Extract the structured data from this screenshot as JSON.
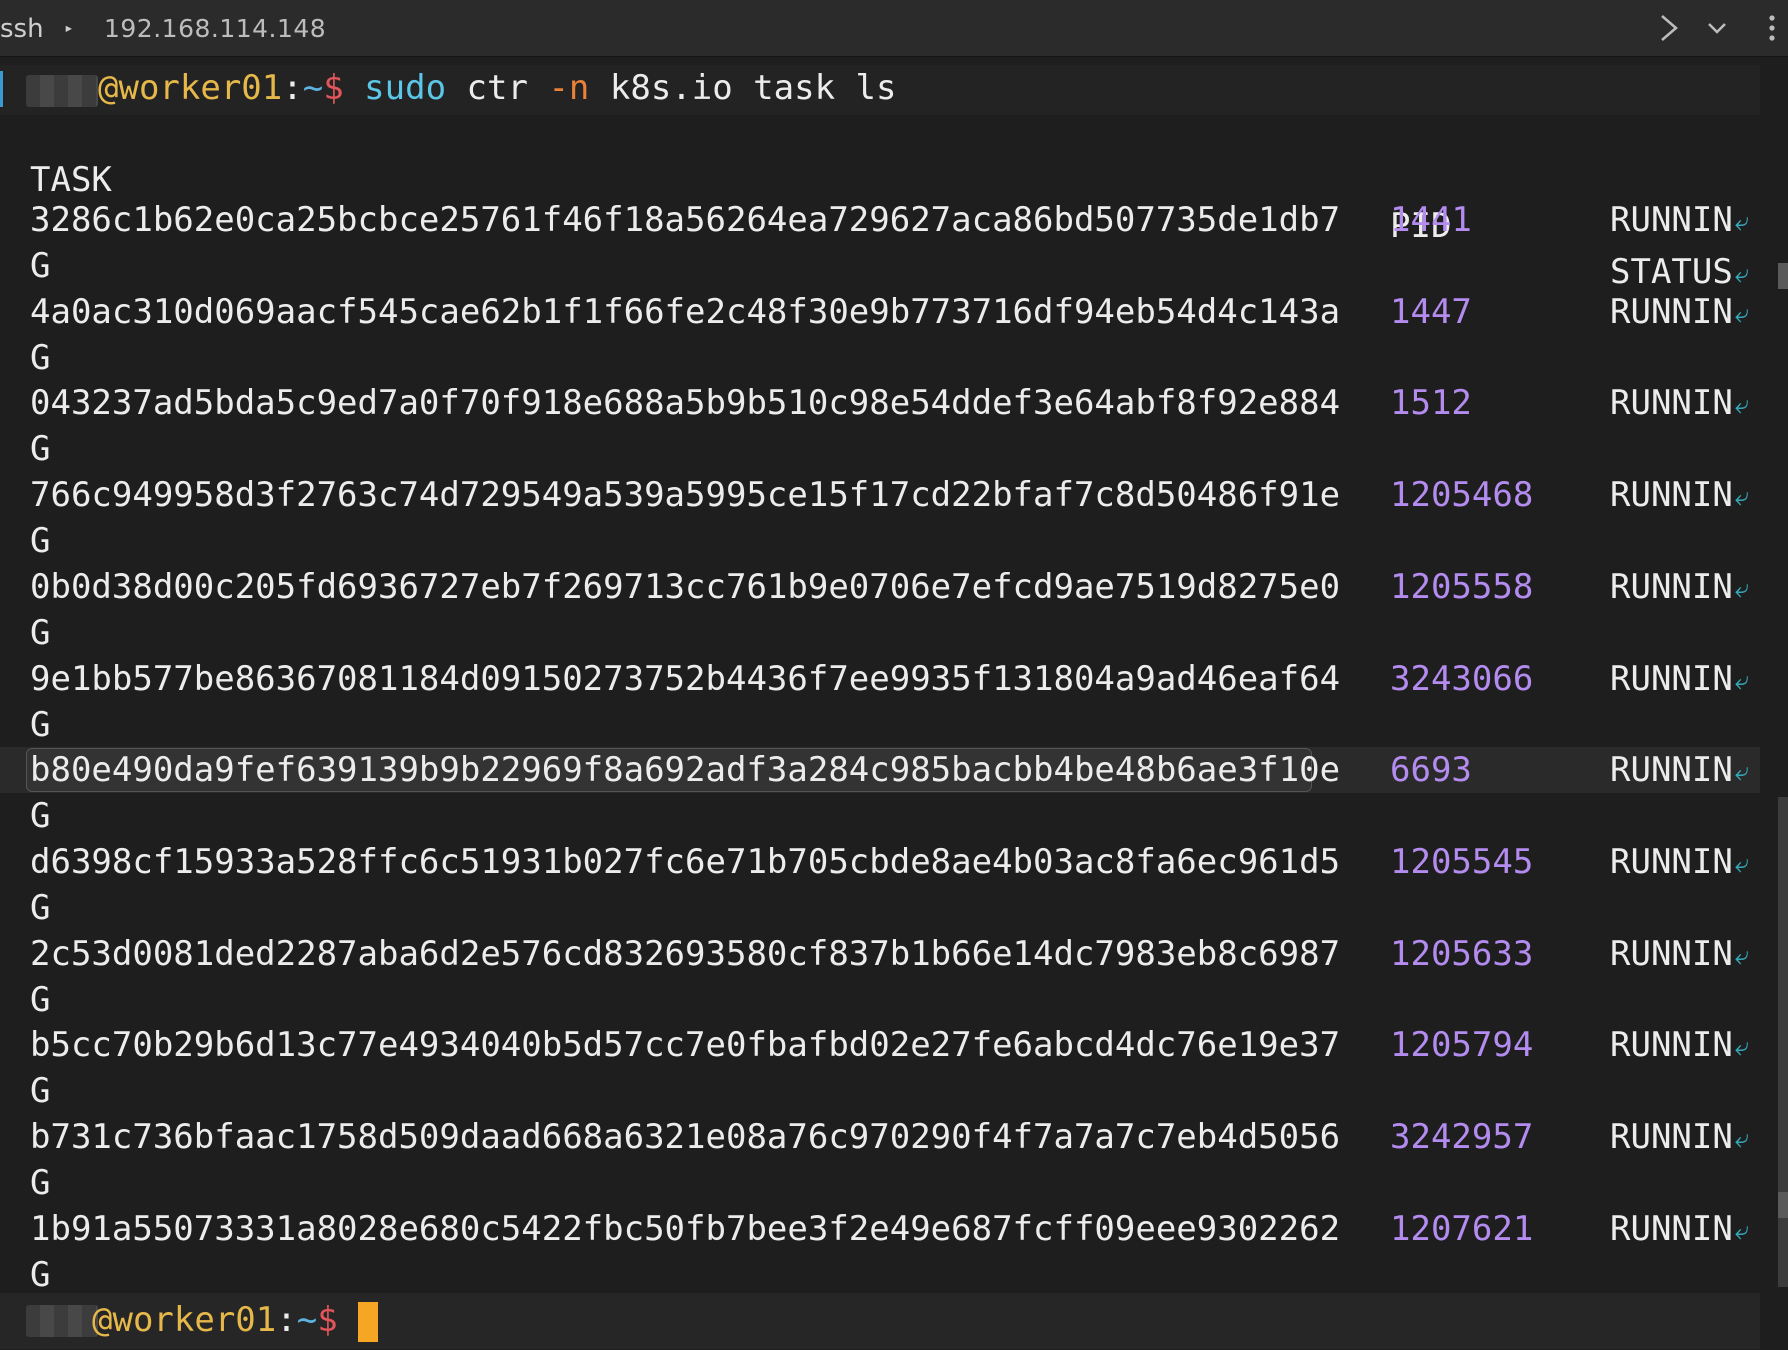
{
  "tabbar": {
    "app": "ssh",
    "separator": "▸",
    "host": "192.168.114.148",
    "next_glyph": "›",
    "dropdown_glyph": "⌄",
    "menu_glyph": "⋮"
  },
  "prompt": {
    "host": "@worker01",
    "colon": ":",
    "path": "~",
    "dollar": "$"
  },
  "command": {
    "sudo": "sudo",
    "ctr": "ctr",
    "flag": "-n",
    "rest": "k8s.io task ls"
  },
  "table": {
    "headers": {
      "task": "TASK",
      "pid": "PID",
      "status": "STATUS"
    },
    "wrap_char": "G",
    "rows": [
      {
        "task": "3286c1b62e0ca25bcbce25761f46f18a56264ea729627aca86bd507735de1db7",
        "pid": "1441",
        "status": "RUNNIN"
      },
      {
        "task": "4a0ac310d069aacf545cae62b1f1f66fe2c48f30e9b773716df94eb54d4c143a",
        "pid": "1447",
        "status": "RUNNIN"
      },
      {
        "task": "043237ad5bda5c9ed7a0f70f918e688a5b9b510c98e54ddef3e64abf8f92e884",
        "pid": "1512",
        "status": "RUNNIN"
      },
      {
        "task": "766c949958d3f2763c74d729549a539a5995ce15f17cd22bfaf7c8d50486f91e",
        "pid": "1205468",
        "status": "RUNNIN"
      },
      {
        "task": "0b0d38d00c205fd6936727eb7f269713cc761b9e0706e7efcd9ae7519d8275e0",
        "pid": "1205558",
        "status": "RUNNIN"
      },
      {
        "task": "9e1bb577be86367081184d09150273752b4436f7ee9935f131804a9ad46eaf64",
        "pid": "3243066",
        "status": "RUNNIN"
      },
      {
        "task": "b80e490da9fef639139b9b22969f8a692adf3a284c985bacbb4be48b6ae3f10e",
        "pid": "6693",
        "status": "RUNNIN"
      },
      {
        "task": "d6398cf15933a528ffc6c51931b027fc6e71b705cbde8ae4b03ac8fa6ec961d5",
        "pid": "1205545",
        "status": "RUNNIN"
      },
      {
        "task": "2c53d0081ded2287aba6d2e576cd832693580cf837b1b66e14dc7983eb8c6987",
        "pid": "1205633",
        "status": "RUNNIN"
      },
      {
        "task": "b5cc70b29b6d13c77e4934040b5d57cc7e0fbafbd02e27fe6abcd4dc76e19e37",
        "pid": "1205794",
        "status": "RUNNIN"
      },
      {
        "task": "b731c736bfaac1758d509daad668a6321e08a76c970290f4f7a7a7c7eb4d5056",
        "pid": "3242957",
        "status": "RUNNIN"
      },
      {
        "task": "1b91a55073331a8028e680c5422fbc50fb7bee3f2e49e687fcff09eee9302262",
        "pid": "1207621",
        "status": "RUNNIN"
      }
    ],
    "highlighted_row": 6
  },
  "colors": {
    "background": "#1e1e1e",
    "pid": "#b48cf0",
    "prompt_host": "#e6b84a",
    "cursor": "#f5a623"
  }
}
